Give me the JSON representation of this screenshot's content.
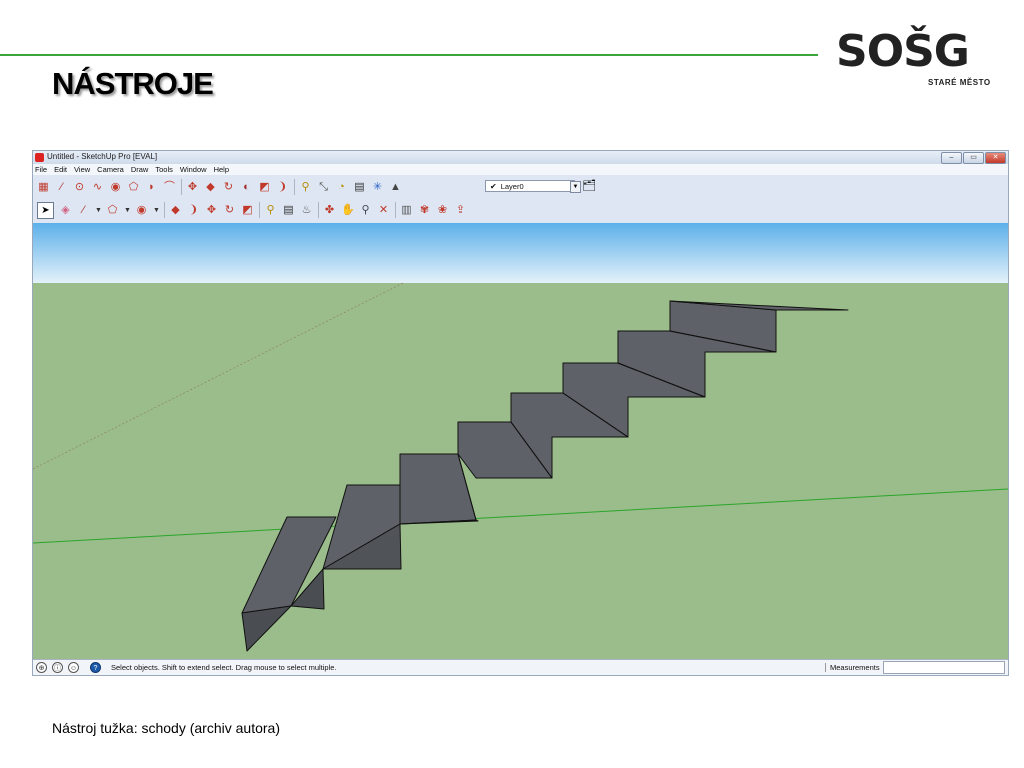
{
  "slide": {
    "title": "NÁSTROJE",
    "caption": "Nástroj tužka: schody (archiv autora)"
  },
  "logo": {
    "word": "SOŠG",
    "subtitle": "STARÉ MĚSTO",
    "colors": {
      "dark": "#222222",
      "green": "#8cc63f"
    }
  },
  "app": {
    "window_title": "Untitled - SketchUp Pro [EVAL]",
    "window_buttons": [
      "–",
      "▭",
      "✕"
    ],
    "menu": [
      "File",
      "Edit",
      "View",
      "Camera",
      "Draw",
      "Tools",
      "Window",
      "Help"
    ],
    "toolbar1": [
      "rectangle-icon",
      "line-icon",
      "circle-icon",
      "freehand-icon",
      "circle-icon",
      "polygon-icon",
      "arc-icon",
      "arc-icon",
      "move-icon",
      "push-pull-icon",
      "rotate-icon",
      "follow-me-icon",
      "scale-icon",
      "offset-icon",
      "tape-measure-icon",
      "dimension-icon",
      "protractor-icon",
      "text-icon",
      "axes-icon",
      "3d-text-icon"
    ],
    "toolbar2": [
      "select-icon",
      "eraser-icon",
      "pencil-icon",
      "polygon-icon",
      "circle-icon",
      "push-pull-icon",
      "offset-icon",
      "move-icon",
      "rotate-icon",
      "scale-icon",
      "tape-measure-icon",
      "text-icon",
      "paint-bucket-icon",
      "orbit-icon",
      "pan-icon",
      "zoom-icon",
      "zoom-extents-icon",
      "warehouse-icon",
      "components-icon",
      "extension-icon",
      "share-icon"
    ],
    "layer": {
      "check": "✔",
      "name": "Layer0"
    },
    "status": {
      "text": "Select objects. Shift to extend select. Drag mouse to select multiple.",
      "measurements_label": "Measurements",
      "measurements_value": ""
    },
    "colors": {
      "sky_top": "#5cb0ea",
      "sky_bottom": "#e3f1f9",
      "ground": "#9bbd8b",
      "face": "#5e6268",
      "face_dark": "#4a4d52",
      "edge": "#111111",
      "green_axis": "#2aa52a"
    }
  }
}
